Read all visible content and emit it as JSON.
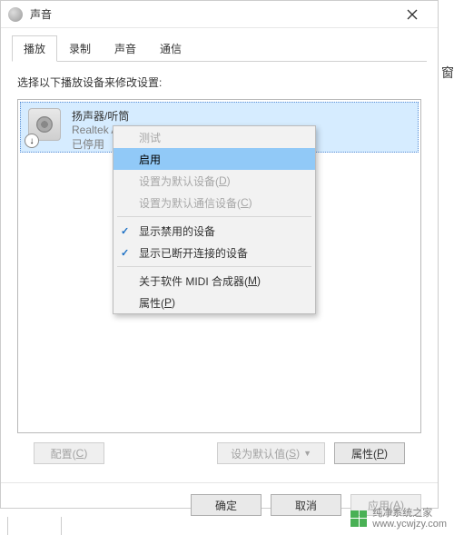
{
  "window": {
    "title": "声音"
  },
  "tabs": [
    "播放",
    "录制",
    "声音",
    "通信"
  ],
  "active_tab_index": 0,
  "instruction": "选择以下播放设备来修改设置:",
  "device": {
    "name": "扬声器/听筒",
    "vendor": "Realtek Audio",
    "status": "已停用"
  },
  "context_menu": {
    "items": [
      {
        "label": "测试",
        "enabled": false
      },
      {
        "label": "启用",
        "enabled": true,
        "highlight": true
      },
      {
        "label_pre": "设置为默认设备(",
        "accel": "D",
        "label_post": ")",
        "enabled": false
      },
      {
        "label_pre": "设置为默认通信设备(",
        "accel": "C",
        "label_post": ")",
        "enabled": false
      },
      {
        "sep": true
      },
      {
        "label": "显示禁用的设备",
        "enabled": true,
        "checked": true
      },
      {
        "label": "显示已断开连接的设备",
        "enabled": true,
        "checked": true
      },
      {
        "sep": true
      },
      {
        "label_pre": "关于软件 MIDI 合成器(",
        "accel": "M",
        "label_post": ")",
        "enabled": true
      },
      {
        "label_pre": "属性(",
        "accel": "P",
        "label_post": ")",
        "enabled": true
      }
    ]
  },
  "bottom_buttons": {
    "configure_pre": "配置(",
    "configure_accel": "C",
    "configure_post": ")",
    "set_default_pre": "设为默认值(",
    "set_default_accel": "S",
    "set_default_post": ")",
    "properties_pre": "属性(",
    "properties_accel": "P",
    "properties_post": ")"
  },
  "dialog_buttons": {
    "ok": "确定",
    "cancel": "取消",
    "apply_pre": "应用(",
    "apply_accel": "A",
    "apply_post": ")"
  },
  "watermark": {
    "line1": "纯净系统之家",
    "line2": "www.ycwjzy.com"
  },
  "side_text": "窗"
}
